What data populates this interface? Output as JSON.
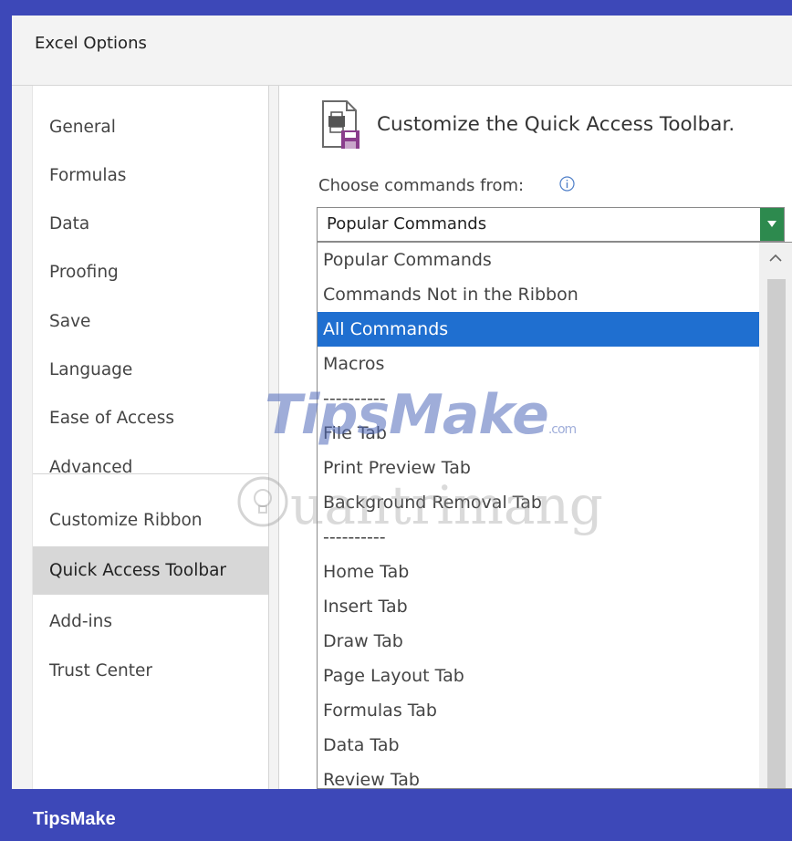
{
  "window": {
    "title": "Excel Options"
  },
  "nav": {
    "items": [
      {
        "label": "General"
      },
      {
        "label": "Formulas"
      },
      {
        "label": "Data"
      },
      {
        "label": "Proofing"
      },
      {
        "label": "Save"
      },
      {
        "label": "Language"
      },
      {
        "label": "Ease of Access"
      },
      {
        "label": "Advanced"
      },
      {
        "label": "Customize Ribbon"
      },
      {
        "label": "Quick Access Toolbar",
        "selected": true
      },
      {
        "label": "Add-ins"
      },
      {
        "label": "Trust Center"
      }
    ]
  },
  "main": {
    "heading": "Customize the Quick Access Toolbar.",
    "heading_icon": "quick-access-toolbar-icon",
    "choose_label": "Choose commands from:",
    "info_icon": "info-icon",
    "combo": {
      "value": "Popular Commands"
    },
    "list": {
      "items": [
        {
          "label": "Popular Commands"
        },
        {
          "label": "Commands Not in the Ribbon"
        },
        {
          "label": "All Commands",
          "highlighted": true
        },
        {
          "label": "Macros"
        },
        {
          "label": "----------"
        },
        {
          "label": "File Tab"
        },
        {
          "label": "Print Preview Tab"
        },
        {
          "label": "Background Removal Tab"
        },
        {
          "label": "----------"
        },
        {
          "label": "Home Tab"
        },
        {
          "label": "Insert Tab"
        },
        {
          "label": "Draw Tab"
        },
        {
          "label": "Page Layout Tab"
        },
        {
          "label": "Formulas Tab"
        },
        {
          "label": "Data Tab"
        },
        {
          "label": "Review Tab"
        }
      ]
    }
  },
  "watermark": {
    "brand": "TipsMake",
    "brand_suffix": ".com",
    "site": "uantrimang"
  },
  "footer": {
    "text": "TipsMake"
  },
  "colors": {
    "frame": "#3d48b8",
    "highlight": "#1f6fd0",
    "combo_button": "#2d8a4e",
    "nav_selected": "#d7d7d7"
  }
}
